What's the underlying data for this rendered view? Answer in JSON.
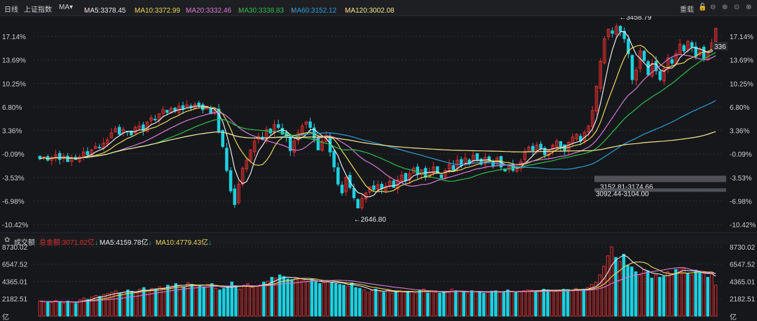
{
  "header": {
    "period": "日线",
    "index_name": "上证指数",
    "indicator": "MA",
    "ma": [
      {
        "label": "MA5:3378.45",
        "color": "#e8e8e8"
      },
      {
        "label": "MA10:3372.99",
        "color": "#e8d85a"
      },
      {
        "label": "MA20:3332.46",
        "color": "#d77bd3"
      },
      {
        "label": "MA30:3338.83",
        "color": "#2bbf4a"
      },
      {
        "label": "MA60:3152.12",
        "color": "#2a9fd6"
      },
      {
        "label": "MA120:3002.08",
        "color": "#f3e58a"
      }
    ],
    "up_arrow": "↑",
    "controls": {
      "restore": "重载",
      "lock_icon": "lock-icon",
      "minus_icon": "minus-icon",
      "plus_icon": "plus-icon",
      "close_icon": "close-icon"
    }
  },
  "volume_header": {
    "title": "成交额",
    "total": "总金额:3071.02亿",
    "ma5": "MA5:4159.78亿",
    "ma10": "MA10:4779.43亿",
    "down_arrow": "↓",
    "settings_icon": "gear-icon"
  },
  "colors": {
    "up": "#e03030",
    "down": "#1ed0e0",
    "bg": "#16171b",
    "grid": "#2e2f34"
  },
  "chart_data": [
    {
      "type": "candlestick",
      "title": "",
      "y_axis_ticks": [
        "17.14%",
        "13.69%",
        "10.25%",
        "6.80%",
        "3.36%",
        "-0.09%",
        "-3.53%",
        "-6.98%",
        "-10.42%"
      ],
      "ylim_pct": [
        -10.42,
        17.14
      ],
      "base_price": 3270,
      "annotations": [
        {
          "label": "3458.79",
          "kind": "high"
        },
        {
          "label": "2646.80",
          "kind": "low"
        },
        {
          "label": "3152.81-3174.66",
          "kind": "gap"
        },
        {
          "label": "3092.44-3104.00",
          "kind": "gap"
        },
        {
          "label": "336",
          "kind": "last"
        }
      ],
      "series": [
        {
          "name": "MA5",
          "color": "#e8e8e8"
        },
        {
          "name": "MA10",
          "color": "#e8d85a"
        },
        {
          "name": "MA20",
          "color": "#d77bd3"
        },
        {
          "name": "MA30",
          "color": "#2bbf4a"
        },
        {
          "name": "MA60",
          "color": "#2a9fd6"
        },
        {
          "name": "MA120",
          "color": "#f3e58a"
        }
      ],
      "close_pct": [
        -0.8,
        -0.5,
        -1.0,
        -0.6,
        -0.2,
        -0.9,
        -0.4,
        -1.2,
        -0.6,
        -0.9,
        -0.5,
        0.2,
        -0.2,
        0.5,
        1.0,
        0.8,
        1.5,
        2.0,
        3.0,
        3.6,
        2.8,
        3.5,
        3.2,
        2.7,
        3.8,
        4.0,
        3.4,
        4.6,
        5.2,
        5.0,
        5.8,
        6.4,
        6.0,
        6.6,
        6.2,
        6.9,
        6.5,
        7.1,
        6.8,
        7.2,
        6.9,
        6.4,
        6.9,
        5.8,
        6.3,
        3.2,
        1.0,
        -2.5,
        -5.5,
        -7.5,
        -4.5,
        -2.2,
        -1.0,
        0.5,
        1.8,
        2.5,
        2.0,
        3.5,
        3.0,
        4.2,
        3.8,
        2.8,
        2.4,
        0.4,
        1.8,
        3.0,
        4.0,
        4.6,
        3.8,
        2.2,
        0.5,
        1.8,
        2.6,
        0.2,
        -2.0,
        -4.5,
        -5.8,
        -3.5,
        -5.0,
        -6.5,
        -8.0,
        -6.6,
        -5.8,
        -4.9,
        -5.3,
        -4.6,
        -5.2,
        -4.8,
        -4.1,
        -5.0,
        -3.9,
        -3.2,
        -4.0,
        -3.0,
        -2.2,
        -3.0,
        -2.4,
        -3.5,
        -2.8,
        -2.0,
        -2.9,
        -3.6,
        -2.5,
        -1.6,
        -2.4,
        -1.0,
        -1.8,
        -0.7,
        -1.5,
        -0.3,
        -0.9,
        -1.6,
        -0.6,
        -1.2,
        -1.8,
        -0.7,
        -2.0,
        -2.6,
        -1.8,
        -2.5,
        -2.0,
        -1.2,
        0.2,
        0.9,
        0.4,
        1.2,
        0.7,
        -0.2,
        0.5,
        1.2,
        1.8,
        1.0,
        0.4,
        1.6,
        2.4,
        2.8,
        1.8,
        3.1,
        4.0,
        6.3,
        9.8,
        13.5,
        16.8,
        18.2,
        17.6,
        18.6,
        17.9,
        16.8,
        14.6,
        10.8,
        12.2,
        15.0,
        13.6,
        11.5,
        13.2,
        12.1,
        10.8,
        12.4,
        14.0,
        13.2,
        14.6,
        16.0,
        15.0,
        16.4,
        15.6,
        14.2,
        15.3,
        13.9,
        14.9,
        16.2,
        18.3
      ]
    },
    {
      "type": "bar",
      "title": "",
      "y_axis_ticks": [
        "8730.02",
        "6547.52",
        "4365.01",
        "2182.51"
      ],
      "ylim": [
        0,
        8730.02
      ],
      "unit": "亿",
      "series": [
        {
          "name": "MA5",
          "color": "#e8e8e8"
        },
        {
          "name": "MA10",
          "color": "#e8d85a"
        },
        {
          "name": "MA20",
          "color": "#d77bd3"
        }
      ],
      "values": [
        1900,
        1800,
        1850,
        1700,
        1950,
        1800,
        1650,
        1900,
        1750,
        1600,
        2050,
        2300,
        2100,
        2400,
        2600,
        2500,
        2700,
        2850,
        3000,
        3200,
        2900,
        3050,
        3300,
        3100,
        2950,
        3400,
        3600,
        3200,
        3500,
        3400,
        3700,
        3600,
        3900,
        3800,
        4100,
        3900,
        3700,
        4200,
        4000,
        3800,
        3900,
        3700,
        4000,
        4100,
        3500,
        3300,
        3500,
        3800,
        4300,
        3700,
        3400,
        3900,
        4100,
        3600,
        3800,
        3900,
        4300,
        4400,
        4900,
        4800,
        5200,
        5000,
        4700,
        4600,
        4800,
        4700,
        4500,
        4400,
        4600,
        4300,
        4100,
        4200,
        4500,
        4300,
        4100,
        4000,
        3900,
        3800,
        4200,
        3600,
        3500,
        3300,
        3000,
        3200,
        3400,
        3100,
        3000,
        3300,
        2900,
        3100,
        3200,
        3000,
        3000,
        3100,
        2900,
        3300,
        3400,
        2900,
        3200,
        3000,
        2900,
        3100,
        3000,
        3400,
        3200,
        3100,
        3000,
        2950,
        3200,
        3100,
        3050,
        2900,
        3000,
        3150,
        3200,
        3000,
        3100,
        3300,
        3050,
        3000,
        3100,
        3200,
        3300,
        3250,
        3100,
        3200,
        3400,
        3300,
        3250,
        3100,
        3300,
        3400,
        3350,
        3200,
        3500,
        3300,
        3400,
        3600,
        4000,
        4300,
        5200,
        6300,
        7600,
        8730,
        7400,
        6900,
        7800,
        6400,
        6200,
        5600,
        5200,
        5900,
        5700,
        4800,
        5200,
        4900,
        5000,
        5600,
        5300,
        5900,
        6100,
        6000,
        5400,
        5200,
        5800,
        5500,
        5400,
        4900,
        5400,
        3900
      ]
    }
  ]
}
